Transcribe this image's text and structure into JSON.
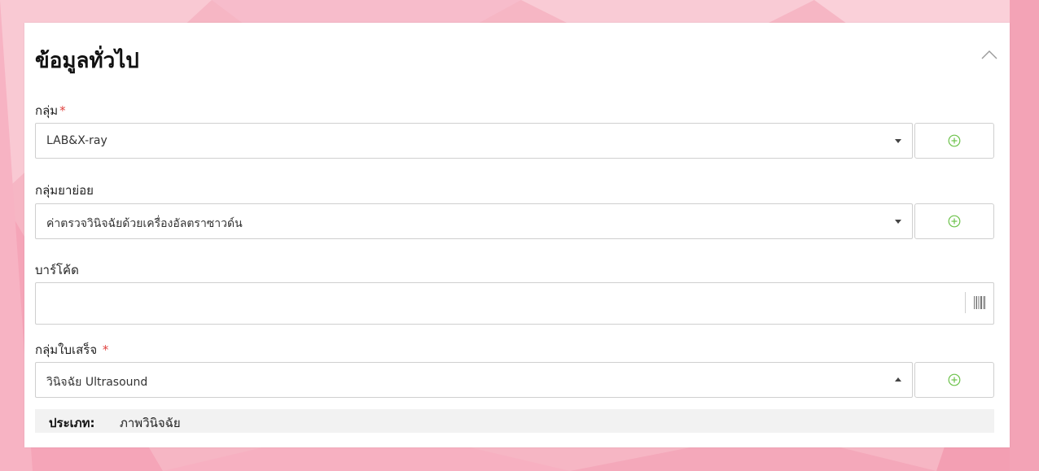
{
  "section": {
    "title": "ข้อมูลทั่วไป"
  },
  "fields": {
    "group": {
      "label": "กลุ่ม",
      "required_mark": "*",
      "value": "LAB&X-ray"
    },
    "subgroup": {
      "label": "กลุ่มยาย่อย",
      "value": "ค่าตรวจวินิจฉัยด้วยเครื่องอัลตราซาวด์น"
    },
    "barcode": {
      "label": "บาร์โค้ด",
      "value": ""
    },
    "receipt_group": {
      "label": "กลุ่มใบเสร็จ",
      "required_mark": "*",
      "value": "วินิจฉัย Ultrasound"
    }
  },
  "type_info": {
    "key": "ประเภท:",
    "value": "ภาพวินิจฉัย"
  },
  "colors": {
    "accent_green": "#6cc24a",
    "required_red": "#e0423f",
    "background_pink": "#f6b6c4"
  },
  "icons": {
    "collapse": "chevron-up-icon",
    "add": "plus-circle-icon",
    "barcode": "barcode-icon"
  }
}
